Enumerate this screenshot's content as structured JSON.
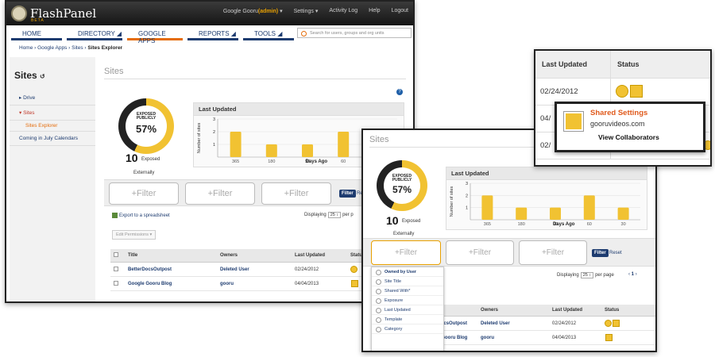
{
  "app": {
    "name": "FlashPanel",
    "beta": "BETA"
  },
  "topnav": {
    "user": "Google Gooru",
    "user_role": "(admin)",
    "settings": "Settings",
    "activity": "Activity Log",
    "help": "Help",
    "logout": "Logout"
  },
  "mainnav": [
    "HOME",
    "DIRECTORY",
    "GOOGLE APPS",
    "REPORTS",
    "TOOLS"
  ],
  "search_placeholder": "Search for users, groups and org units",
  "breadcrumb": {
    "home": "Home",
    "apps": "Google Apps",
    "sites": "Sites",
    "current": "Sites Explorer"
  },
  "sidebar": {
    "title": "Sites",
    "drive": "Drive",
    "sites": "Sites",
    "explorer": "Sites Explorer",
    "coming": "Coming in July Calendars"
  },
  "pane_title": "Sites",
  "donut": {
    "line1": "EXPOSED",
    "line2": "PUBLICLY",
    "pct": "57%",
    "fraction": 0.57
  },
  "exposed": {
    "count": "10",
    "label": "Exposed",
    "label2": "Externally"
  },
  "last_updated_title": "Last Updated",
  "chart_data": {
    "type": "bar",
    "title": "Last Updated",
    "ylabel": "Number of sites",
    "xlabel": "Days Ago",
    "categories": [
      "365",
      "180",
      "90",
      "60",
      "30"
    ],
    "values": [
      2,
      1,
      1,
      2,
      1
    ],
    "ylim": [
      0,
      3
    ],
    "yticks": [
      "1",
      "2",
      "3"
    ]
  },
  "filters": {
    "f1": "+Filter",
    "f2": "+Filter",
    "f3": "+Filter",
    "go": "Filter",
    "reset": "Reset",
    "reset_short": "Res"
  },
  "export": "Export to a spreadsheet",
  "displaying": {
    "label": "Displaying",
    "value": "25",
    "suffix": "per page",
    "suffix_short": "per p",
    "page": "1"
  },
  "edit_permissions": "Edit Permissions",
  "table": {
    "headers": {
      "title": "Title",
      "owners": "Owners",
      "updated": "Last Updated",
      "status": "Status",
      "status_short": "Statu"
    },
    "rows": [
      {
        "title": "BetterDocsOutpost",
        "owner": "Deleted User",
        "date": "02/24/2012"
      },
      {
        "title": "Google Gooru Blog",
        "owner": "gooru",
        "date": "04/04/2013"
      }
    ]
  },
  "dropdown": [
    "Owned by User",
    "Site Title",
    "Shared With*",
    "Exposure",
    "Last Updated",
    "Template",
    "Category"
  ],
  "zoom": {
    "headers": {
      "updated": "Last Updated",
      "status": "Status"
    },
    "rows": [
      "02/24/2012",
      "04/",
      "02/"
    ],
    "tooltip": {
      "title": "Shared Settings",
      "domain": "gooruvideos.com",
      "view": "View Collaborators"
    }
  },
  "colors": {
    "accent": "#f1c232",
    "nav": "#1e3c70",
    "orange": "#e46c0a",
    "tip_title": "#e05a1c"
  }
}
